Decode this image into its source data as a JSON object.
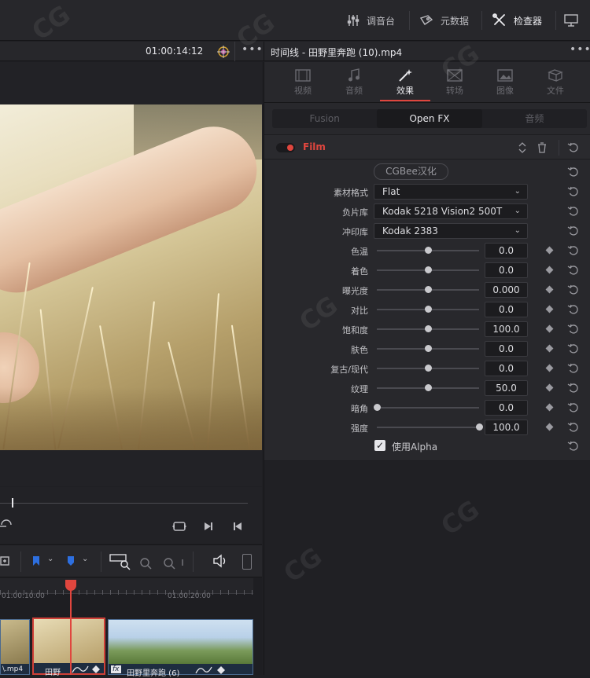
{
  "topbar": {
    "mixer_label": "调音台",
    "metadata_label": "元数据",
    "inspector_label": "检查器"
  },
  "viewer": {
    "timecode": "01:00:14:12"
  },
  "timeline": {
    "ruler_time_1": "01:00:10:00",
    "ruler_time_2": "01:00:20:00",
    "clip_1_name": "\\.mp4",
    "clip_2_name": "田野",
    "clip_3_fx": "fx",
    "clip_3_name": "田野里奔跑 (6)"
  },
  "inspector": {
    "title": "时间线 - 田野里奔跑 (10).mp4",
    "tabs": [
      {
        "label": "视频",
        "icon": "film-icon"
      },
      {
        "label": "音频",
        "icon": "music-note-icon"
      },
      {
        "label": "效果",
        "icon": "magic-wand-icon"
      },
      {
        "label": "转场",
        "icon": "transition-icon"
      },
      {
        "label": "图像",
        "icon": "image-icon"
      },
      {
        "label": "文件",
        "icon": "file-icon"
      }
    ],
    "active_tab": "效果",
    "subtabs": [
      "Fusion",
      "Open FX",
      "音频"
    ],
    "active_subtab": "Open FX",
    "effect_name": "Film",
    "cgbee_button": "CGBee汉化",
    "selects": [
      {
        "label": "素材格式",
        "value": "Flat"
      },
      {
        "label": "负片库",
        "value": "Kodak 5218 Vision2 500T"
      },
      {
        "label": "冲印库",
        "value": "Kodak 2383"
      }
    ],
    "sliders": [
      {
        "label": "色温",
        "value": "0.0",
        "pos": 0.5
      },
      {
        "label": "着色",
        "value": "0.0",
        "pos": 0.5
      },
      {
        "label": "曝光度",
        "value": "0.000",
        "pos": 0.5
      },
      {
        "label": "对比",
        "value": "0.0",
        "pos": 0.5
      },
      {
        "label": "饱和度",
        "value": "100.0",
        "pos": 0.5
      },
      {
        "label": "肤色",
        "value": "0.0",
        "pos": 0.5
      },
      {
        "label": "复古/现代",
        "value": "0.0",
        "pos": 0.5
      },
      {
        "label": "纹理",
        "value": "50.0",
        "pos": 0.5
      },
      {
        "label": "暗角",
        "value": "0.0",
        "pos": 0.0
      },
      {
        "label": "强度",
        "value": "100.0",
        "pos": 1.0
      }
    ],
    "alpha_label": "使用Alpha",
    "alpha_checked": true
  },
  "colors": {
    "accent_red": "#e0463e",
    "playhead": "#e0463e",
    "marker_blue": "#2d6fe0"
  }
}
